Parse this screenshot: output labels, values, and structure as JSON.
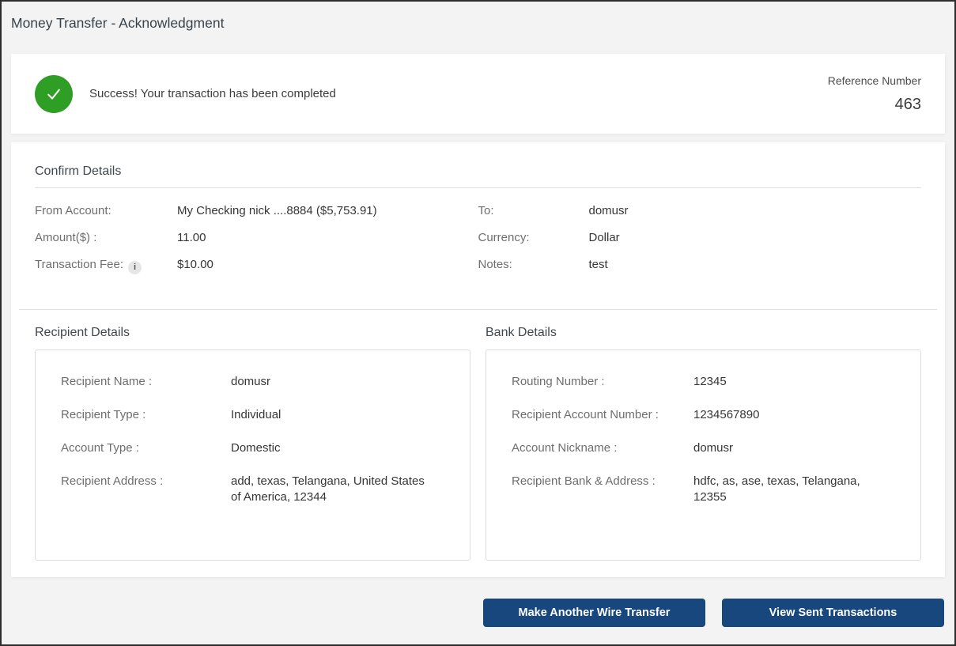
{
  "page": {
    "title": "Money Transfer - Acknowledgment"
  },
  "banner": {
    "message": "Success! Your transaction has been completed",
    "reference_label": "Reference Number",
    "reference_value": "463",
    "success_icon": "check-icon",
    "success_color": "#2e9e24"
  },
  "confirm": {
    "heading": "Confirm Details",
    "left": [
      {
        "label": "From Account:",
        "value": "My Checking nick ....8884 ($5,753.91)"
      },
      {
        "label": "Amount($) :",
        "value": "11.00"
      },
      {
        "label": "Transaction Fee:",
        "value": "$10.00",
        "info_icon": "i"
      }
    ],
    "right": [
      {
        "label": "To:",
        "value": "domusr"
      },
      {
        "label": "Currency:",
        "value": "Dollar"
      },
      {
        "label": "Notes:",
        "value": "test"
      }
    ]
  },
  "recipient": {
    "heading": "Recipient Details",
    "rows": [
      {
        "label": "Recipient Name :",
        "value": "domusr"
      },
      {
        "label": "Recipient Type :",
        "value": "Individual"
      },
      {
        "label": "Account Type :",
        "value": "Domestic"
      },
      {
        "label": "Recipient Address :",
        "value": "add, texas, Telangana, United States of America, 12344"
      }
    ]
  },
  "bank": {
    "heading": "Bank Details",
    "rows": [
      {
        "label": "Routing Number :",
        "value": "12345"
      },
      {
        "label": "Recipient Account Number :",
        "value": "1234567890"
      },
      {
        "label": "Account Nickname :",
        "value": "domusr"
      },
      {
        "label": "Recipient Bank & Address :",
        "value": "hdfc, as, ase, texas, Telangana, 12355"
      }
    ]
  },
  "actions": {
    "make_another_label": "Make Another Wire Transfer",
    "view_sent_label": "View Sent Transactions",
    "button_color": "#17477c"
  }
}
